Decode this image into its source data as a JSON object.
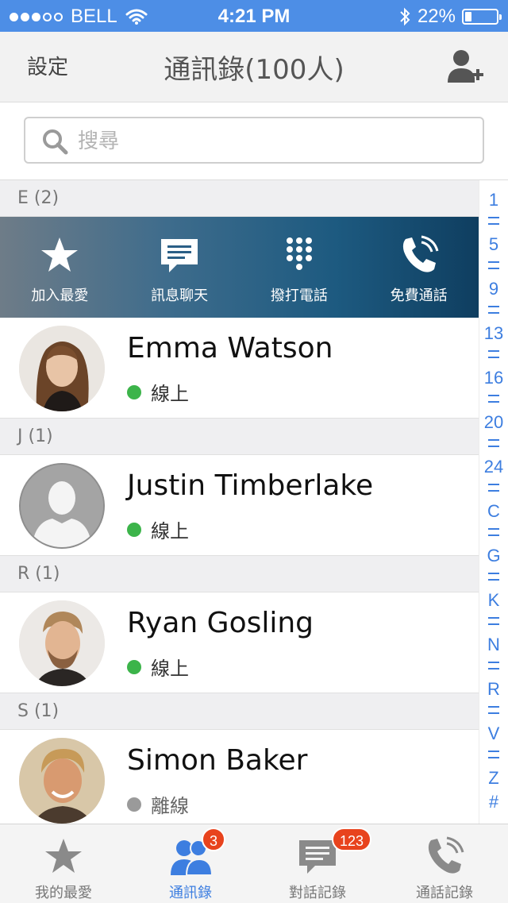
{
  "status_bar": {
    "carrier": "BELL",
    "time": "4:21 PM",
    "battery_percent": "22%",
    "battery_level": 0.22,
    "signal_bars_filled": 3,
    "signal_bars_total": 5
  },
  "nav": {
    "left_label": "設定",
    "title": "通訊錄(100人)",
    "right_icon": "add-contact-icon"
  },
  "search": {
    "placeholder": "搜尋",
    "value": ""
  },
  "actions": [
    {
      "label": "加入最愛",
      "icon": "star-icon"
    },
    {
      "label": "訊息聊天",
      "icon": "chat-icon"
    },
    {
      "label": "撥打電話",
      "icon": "keypad-icon"
    },
    {
      "label": "免費通話",
      "icon": "phone-icon"
    }
  ],
  "sections": [
    {
      "header": "E (2)",
      "contacts": [
        {
          "name": "Emma Watson",
          "status": "線上",
          "online": true
        }
      ]
    },
    {
      "header": "J (1)",
      "contacts": [
        {
          "name": "Justin Timberlake",
          "status": "線上",
          "online": true
        }
      ]
    },
    {
      "header": "R (1)",
      "contacts": [
        {
          "name": "Ryan Gosling",
          "status": "線上",
          "online": true
        }
      ]
    },
    {
      "header": "S (1)",
      "contacts": [
        {
          "name": "Simon Baker",
          "status": "離線",
          "online": false
        }
      ]
    }
  ],
  "index": [
    "1",
    "5",
    "9",
    "13",
    "16",
    "20",
    "24",
    "C",
    "G",
    "K",
    "N",
    "R",
    "V",
    "Z",
    "#"
  ],
  "tabs": [
    {
      "label": "我的最愛",
      "icon": "star-icon",
      "badge": "",
      "active": false
    },
    {
      "label": "通訊錄",
      "icon": "contacts-icon",
      "badge": "3",
      "active": true
    },
    {
      "label": "對話記錄",
      "icon": "chat-icon",
      "badge": "123",
      "active": false
    },
    {
      "label": "通話記錄",
      "icon": "phone-icon",
      "badge": "",
      "active": false
    }
  ],
  "colors": {
    "accent": "#3d7ee0",
    "status_bar": "#4d8ee6",
    "online": "#3cb44a",
    "offline": "#9a9a9a",
    "badge": "#e8431d"
  }
}
